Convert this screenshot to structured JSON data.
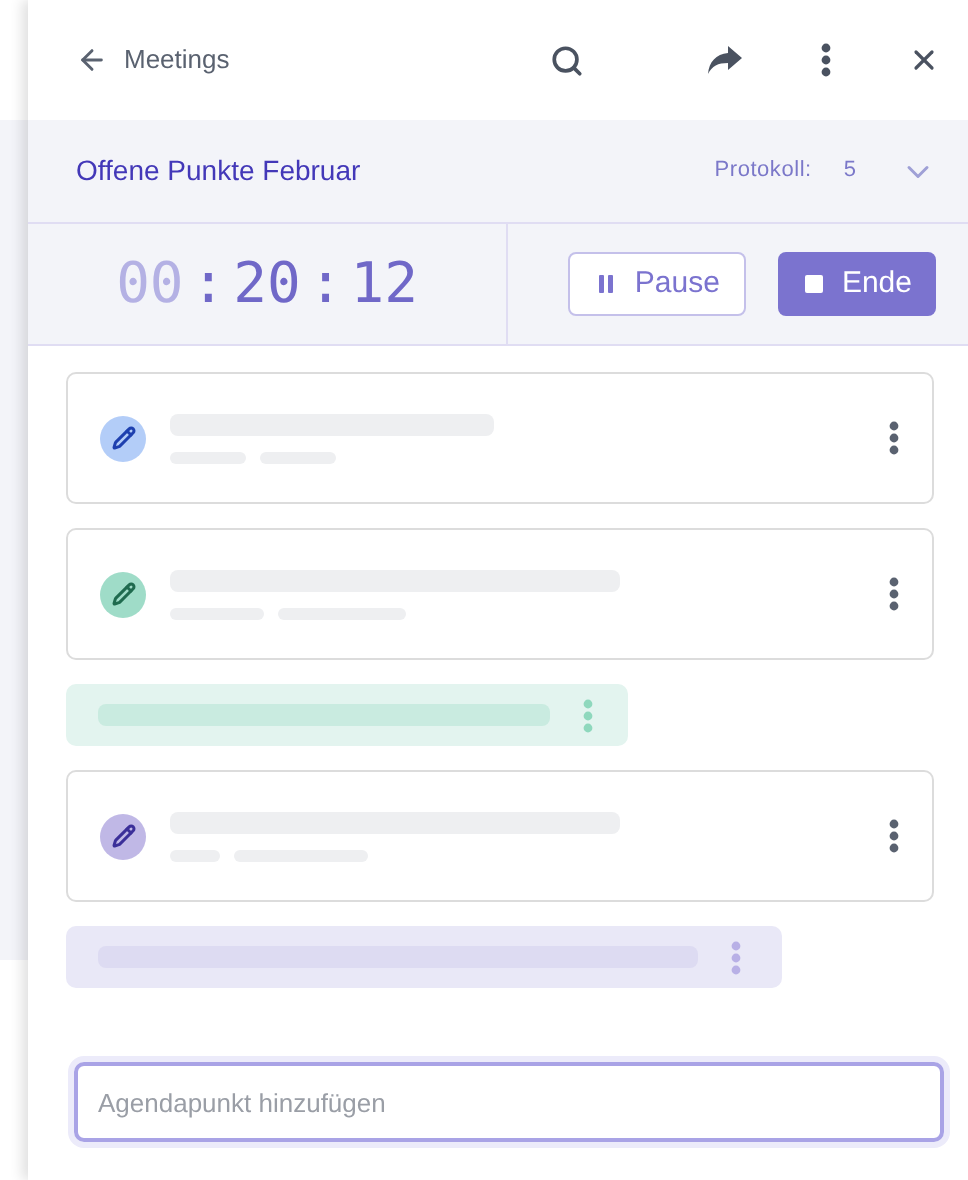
{
  "header": {
    "back_label": "Meetings"
  },
  "meeting": {
    "title": "Offene Punkte Februar",
    "protocol_label": "Protokoll:",
    "protocol_value": "5",
    "expanded": false
  },
  "timer": [
    {
      "text": "00",
      "dimmed": true
    },
    {
      "text": ":",
      "dimmed": false
    },
    {
      "text": "20",
      "dimmed": false
    },
    {
      "text": ":",
      "dimmed": false
    },
    {
      "text": "12",
      "dimmed": false
    }
  ],
  "controls": {
    "pause": "Pause",
    "end": "Ende"
  },
  "items": [
    {
      "kind": "card",
      "color": "#b3cdf8"
    },
    {
      "kind": "card",
      "color": "#9fdcc8"
    },
    {
      "kind": "note",
      "color": "#e3f4ef"
    },
    {
      "kind": "card",
      "color": "#c0b8e6"
    },
    {
      "kind": "note",
      "color": "#e9e8f7"
    }
  ],
  "add_field": {
    "placeholder": "Agendapunkt hinzufügen"
  }
}
